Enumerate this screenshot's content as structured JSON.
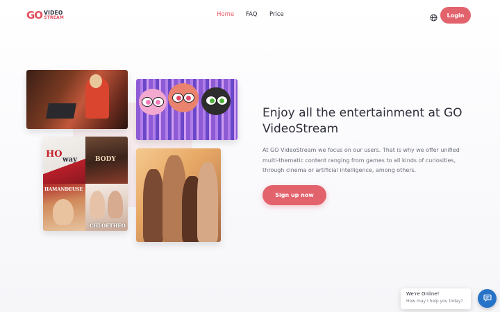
{
  "header": {
    "logo_go": "GO",
    "logo_word1": "VIDEO",
    "logo_word2": "STREAM",
    "nav": [
      {
        "label": "Home",
        "active": true
      },
      {
        "label": "FAQ",
        "active": false
      },
      {
        "label": "Price",
        "active": false
      }
    ],
    "language_icon": "globe-icon",
    "login_label": "Login"
  },
  "hero": {
    "title": "Enjoy all the entertainment at GO VideoStream",
    "description": "At GO VideoStream we focus on our users. That is why we offer unified multi-thematic content ranging from games to all kinds of curiosities, through cinema or artificial intelligence, among others.",
    "cta_label": "Sign up now",
    "posters": {
      "q1_text": "HO",
      "q1_sub": "way",
      "q2_text": "BODY",
      "q3_text": "HAMANDEUSE",
      "q4_text": "CHLOETHEO"
    }
  },
  "chat": {
    "title": "We're Online!",
    "subtitle": "How may I help you today?",
    "icon": "chat-icon"
  },
  "colors": {
    "accent": "#e3636d",
    "text": "#2d2f3a",
    "chat_button": "#2673c8"
  }
}
